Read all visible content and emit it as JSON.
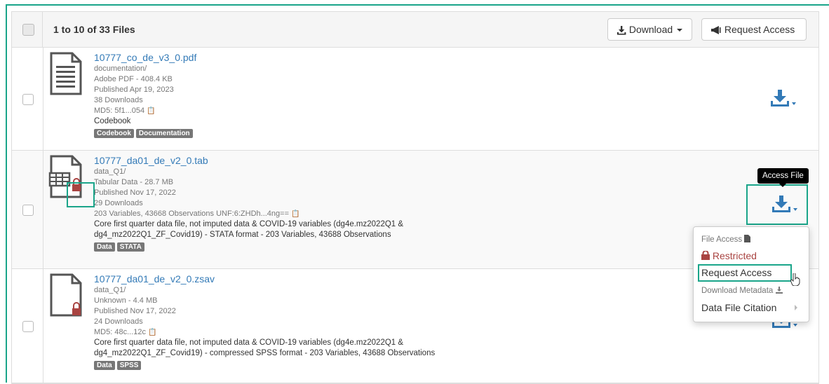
{
  "header": {
    "count_text": "1 to 10 of 33 Files",
    "download_label": "Download",
    "request_access_label": "Request Access"
  },
  "files": [
    {
      "name": "10777_co_de_v3_0.pdf",
      "path": "documentation/",
      "type_size": "Adobe PDF - 408.4 KB",
      "published": "Published Apr 19, 2023",
      "downloads": "38 Downloads",
      "checksum": "MD5: 5f1...054",
      "description": "Codebook",
      "tags": [
        "Codebook",
        "Documentation"
      ],
      "icon": "pdf-document-icon"
    },
    {
      "name": "10777_da01_de_v2_0.tab",
      "path": "data_Q1/",
      "type_size": "Tabular Data - 28.7 MB",
      "published": "Published Nov 17, 2022",
      "downloads": "29 Downloads",
      "checksum": "203 Variables, 43668 Observations UNF:6:ZHDh...4ng==",
      "description_1": "Core first quarter data file, not imputed data & COVID-19 variables (dg4e.mz2022Q1 &",
      "description_2": "dg4_mz2022Q1_ZF_Covid19) - STATA format - 203 Variables, 43688 Observations",
      "tags": [
        "Data",
        "STATA"
      ],
      "icon": "tabular-file-icon",
      "restricted": true
    },
    {
      "name": "10777_da01_de_v2_0.zsav",
      "path": "data_Q1/",
      "type_size": "Unknown - 4.4 MB",
      "published": "Published Nov 17, 2022",
      "downloads": "24 Downloads",
      "checksum": "MD5: 48c...12c",
      "description_1": "Core first quarter data file, not imputed data & COVID-19 variables (dg4e.mz2022Q1 &",
      "description_2": "dg4_mz2022Q1_ZF_Covid19) - compressed SPSS format - 203 Variables, 43688 Observations",
      "tags": [
        "Data",
        "SPSS"
      ],
      "icon": "generic-file-icon",
      "restricted": true
    }
  ],
  "tooltip": "Access File",
  "menu": {
    "file_access_header": "File Access",
    "restricted_label": "Restricted",
    "request_access": "Request Access",
    "download_metadata_header": "Download Metadata",
    "data_file_citation": "Data File Citation"
  },
  "colors": {
    "accent_highlight": "#1aa58a",
    "link": "#337ab7",
    "restricted": "#a94442"
  }
}
